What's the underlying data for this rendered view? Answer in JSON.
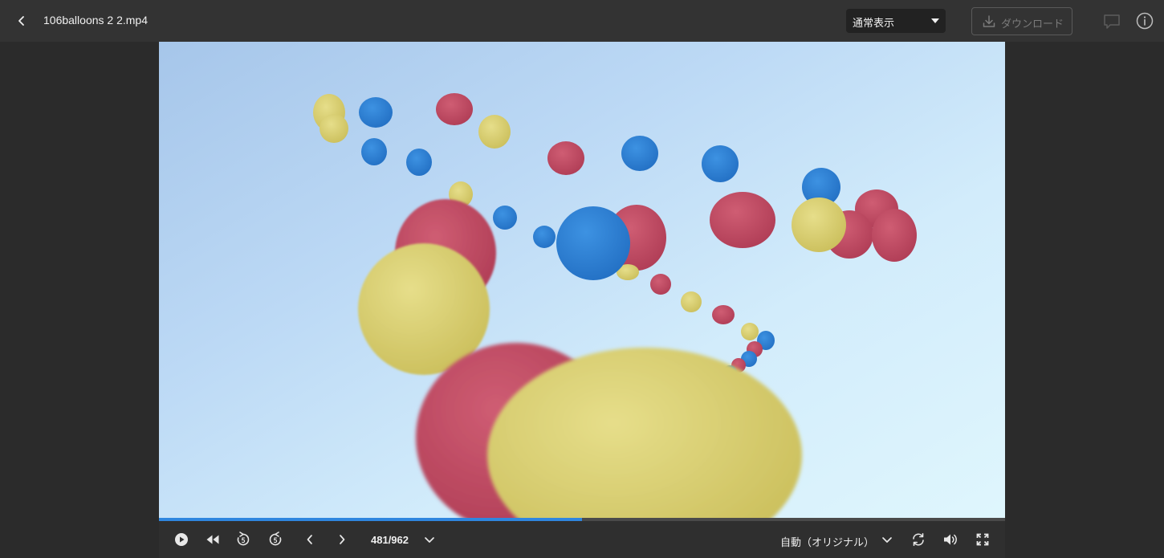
{
  "header": {
    "file_name": "106balloons 2 2.mp4",
    "view_mode": "通常表示",
    "download_label": "ダウンロード",
    "icons": [
      "chevron-left-icon",
      "download-icon",
      "comment-icon",
      "info-icon"
    ]
  },
  "player": {
    "progress_fraction": 0.5,
    "frame_counter": "481/962",
    "quality_label": "自動（オリジナル）",
    "accent_color": "#2f86df",
    "controls": [
      "play",
      "rewind",
      "skip-back-5",
      "skip-forward-5",
      "previous-frame",
      "next-frame",
      "frame-menu",
      "quality-menu",
      "loop",
      "volume",
      "fullscreen"
    ]
  },
  "balloon_colors": {
    "red": "#c14b62",
    "blue": "#2c7fd3",
    "yellow": "#d6cc6e"
  }
}
